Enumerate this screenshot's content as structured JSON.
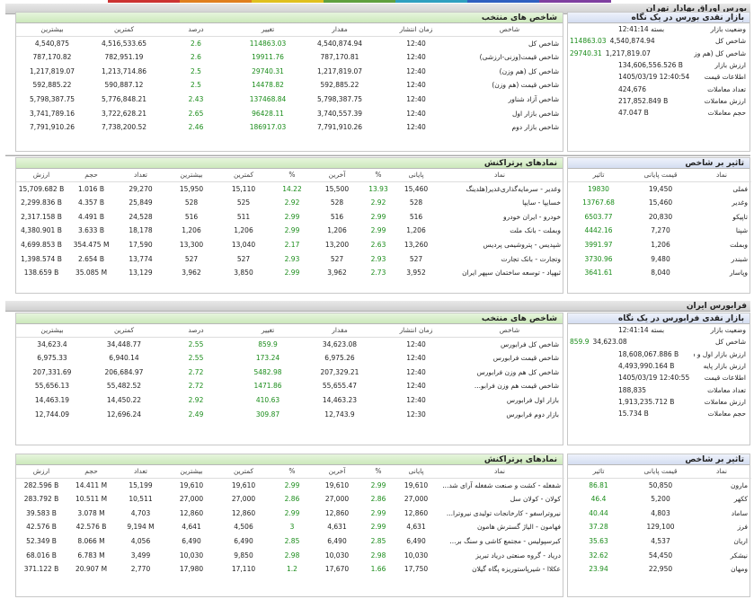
{
  "colors": {
    "up": "#1a8c1a",
    "down": "#cc0000",
    "green_header": "#cce8bb",
    "blue_header": "#d4ddf1",
    "top_strip": [
      "#cc3333",
      "#e08020",
      "#e0c020",
      "#60a040",
      "#30a0c0",
      "#3060c0",
      "#8040a0"
    ]
  },
  "tse": {
    "title": "بورس اوراق بهادار تهران",
    "glance": {
      "title": "بازار نقدی بورس در یک نگاه",
      "rows": [
        {
          "label": "وضعیت بازار",
          "value": "بسته 12:41:14",
          "change": ""
        },
        {
          "label": "شاخص کل",
          "value": "4,540,874.94",
          "change": "114863.03"
        },
        {
          "label": "شاخص کل (هم وزن)",
          "value": "1,217,819.07",
          "change": "29740.31"
        },
        {
          "label": "ارزش بازار",
          "value": "134,606,556.526 B",
          "change": ""
        },
        {
          "label": "اطلاعات قیمت",
          "value": "1405/03/19 12:40:54",
          "change": ""
        },
        {
          "label": "تعداد معاملات",
          "value": "424,676",
          "change": ""
        },
        {
          "label": "ارزش معاملات",
          "value": "217,852.849 B",
          "change": ""
        },
        {
          "label": "حجم معاملات",
          "value": "47.047 B",
          "change": ""
        }
      ]
    },
    "indices": {
      "title": "شاخص های منتخب",
      "headers": [
        "شاخص",
        "زمان انتشار",
        "مقدار",
        "تغییر",
        "درصد",
        "کمترین",
        "بیشترین"
      ],
      "rows": [
        [
          "شاخص کل",
          "12:40",
          "4,540,874.94",
          "114863.03",
          "2.6",
          "4,516,533.65",
          "4,540,875"
        ],
        [
          "شاخص قیمت(وزنی-ارزشی)",
          "12:40",
          "787,170.81",
          "19911.76",
          "2.6",
          "782,951.19",
          "787,170.82"
        ],
        [
          "شاخص کل (هم وزن)",
          "12:40",
          "1,217,819.07",
          "29740.31",
          "2.5",
          "1,213,714.86",
          "1,217,819.07"
        ],
        [
          "شاخص قیمت (هم وزن)",
          "12:40",
          "592,885.22",
          "14478.82",
          "2.5",
          "590,887.12",
          "592,885.22"
        ],
        [
          "شاخص آزاد شناور",
          "12:40",
          "5,798,387.75",
          "137468.84",
          "2.43",
          "5,776,848.21",
          "5,798,387.75"
        ],
        [
          "شاخص بازار اول",
          "12:40",
          "3,740,557.39",
          "96428.11",
          "2.65",
          "3,722,628.21",
          "3,741,789.16"
        ],
        [
          "شاخص بازار دوم",
          "12:40",
          "7,791,910.26",
          "186917.03",
          "2.46",
          "7,738,200.52",
          "7,791,910.26"
        ]
      ]
    },
    "symbols": {
      "title": "نمادهای پرتراکنش",
      "headers": [
        "نماد",
        "پایانی",
        "%",
        "آخرین",
        "%",
        "کمترین",
        "بیشترین",
        "تعداد",
        "حجم",
        "ارزش"
      ],
      "rows": [
        [
          "وغدیر - سرمایه‌گذاری‌غدیر(هلدینگ",
          "15,460",
          "13.93",
          "15,500",
          "14.22",
          "15,110",
          "15,950",
          "29,270",
          "1.016 B",
          "15,709.682 B"
        ],
        [
          "خسایپا - سایپا",
          "528",
          "2.92",
          "528",
          "2.92",
          "525",
          "528",
          "25,849",
          "4.357 B",
          "2,299.836 B"
        ],
        [
          "خودرو - ایران‌ خودرو",
          "516",
          "2.99",
          "516",
          "2.99",
          "511",
          "516",
          "24,528",
          "4.491 B",
          "2,317.158 B"
        ],
        [
          "وبملت - بانک ملت",
          "1,206",
          "2.99",
          "1,206",
          "2.99",
          "1,206",
          "1,206",
          "18,178",
          "3.633 B",
          "4,380.901 B"
        ],
        [
          "شپدیس - پتروشیمی پردیس",
          "13,260",
          "2.63",
          "13,200",
          "2.17",
          "13,040",
          "13,300",
          "17,590",
          "354.475 M",
          "4,699.853 B"
        ],
        [
          "وتجارت - بانک تجارت",
          "527",
          "2.93",
          "527",
          "2.93",
          "527",
          "527",
          "13,774",
          "2.654 B",
          "1,398.574 B"
        ],
        [
          "ثبهپاد - توسعه ساختمان سپهر ایران",
          "3,952",
          "2.73",
          "3,962",
          "2.99",
          "3,850",
          "3,962",
          "13,129",
          "35.085 M",
          "138.659 B"
        ]
      ]
    },
    "impact": {
      "title": "تاثیر بر شاخص",
      "headers": [
        "نماد",
        "قیمت پایانی",
        "تاثیر"
      ],
      "rows": [
        [
          "فملی",
          "19,450",
          "19830"
        ],
        [
          "وغدیر",
          "15,460",
          "13767.68"
        ],
        [
          "تاپیکو",
          "20,830",
          "6503.77"
        ],
        [
          "شپنا",
          "7,270",
          "4442.16"
        ],
        [
          "وبملت",
          "1,206",
          "3991.97"
        ],
        [
          "شبندر",
          "9,480",
          "3730.96"
        ],
        [
          "وپاسار",
          "8,040",
          "3641.61"
        ]
      ]
    }
  },
  "ifb": {
    "title": "فرابورس ایران",
    "glance": {
      "title": "بازار نقدی فرابورس در یک نگاه",
      "rows": [
        {
          "label": "وضعیت بازار",
          "value": "بسته 12:41:14",
          "change": ""
        },
        {
          "label": "شاخص کل",
          "value": "34,623.08",
          "change": "859.9"
        },
        {
          "label": "ارزش بازار اول و دوم",
          "value": "18,608,067.886 B",
          "change": ""
        },
        {
          "label": "ارزش بازار پایه",
          "value": "4,493,990.164 B",
          "change": ""
        },
        {
          "label": "اطلاعات قیمت",
          "value": "1405/03/19 12:40:55",
          "change": ""
        },
        {
          "label": "تعداد معاملات",
          "value": "188,835",
          "change": ""
        },
        {
          "label": "ارزش معاملات",
          "value": "1,913,235.712 B",
          "change": ""
        },
        {
          "label": "حجم معاملات",
          "value": "15.734 B",
          "change": ""
        }
      ]
    },
    "indices": {
      "title": "شاخص های منتخب",
      "headers": [
        "شاخص",
        "زمان انتشار",
        "مقدار",
        "تغییر",
        "درصد",
        "کمترین",
        "بیشترین"
      ],
      "rows": [
        [
          "شاخص کل فرابورس",
          "12:40",
          "34,623.08",
          "859.9",
          "2.55",
          "34,448.77",
          "34,623.4"
        ],
        [
          "شاخص قیمت فرابورس",
          "12:40",
          "6,975.26",
          "173.24",
          "2.55",
          "6,940.14",
          "6,975.33"
        ],
        [
          "شاخص کل هم وزن فرابورس",
          "12:40",
          "207,329.21",
          "5482.98",
          "2.72",
          "206,684.97",
          "207,331.69"
        ],
        [
          "شاخص قیمت هم وزن فرابو...",
          "12:40",
          "55,655.47",
          "1471.86",
          "2.72",
          "55,482.52",
          "55,656.13"
        ],
        [
          "بازار اول فرابورس",
          "12:40",
          "14,463.23",
          "410.63",
          "2.92",
          "14,450.22",
          "14,463.19"
        ],
        [
          "بازار دوم فرابورس",
          "12:30",
          "12,743.9",
          "309.87",
          "2.49",
          "12,696.24",
          "12,744.09"
        ]
      ]
    },
    "symbols": {
      "title": "نمادهای پرتراکنش",
      "headers": [
        "نماد",
        "پایانی",
        "%",
        "آخرین",
        "%",
        "کمترین",
        "بیشترین",
        "تعداد",
        "حجم",
        "ارزش"
      ],
      "rows": [
        [
          "شفغله - کشت و صنعت شفغله آرای شد...",
          "19,610",
          "2.99",
          "19,610",
          "2.99",
          "19,610",
          "19,610",
          "15,199",
          "14.411 M",
          "282.596 B"
        ],
        [
          "کولان - کولان سل",
          "27,000",
          "2.86",
          "27,000",
          "2.86",
          "27,000",
          "27,000",
          "10,511",
          "10.511 M",
          "283.792 B"
        ],
        [
          "نیروتراسفو - کارخانجات تولیدی نیروترا...",
          "12,860",
          "2.99",
          "12,860",
          "2.99",
          "12,860",
          "12,860",
          "4,703",
          "3.078 M",
          "39.583 B"
        ],
        [
          "فهامون - الیاژ گسترش هامون",
          "4,631",
          "2.99",
          "4,631",
          "3",
          "4,506",
          "4,641",
          "9,194 M",
          "42.576 B",
          "42.576 B"
        ],
        [
          "کبرسپولیس - مجتمع کاشی و سنگ بر...",
          "6,490",
          "2.85",
          "6,490",
          "2.85",
          "6,490",
          "6,490",
          "4,056",
          "8.066 M",
          "52.349 B"
        ],
        [
          "دریاد - گروه صنعتی دریاد تبریز",
          "10,030",
          "2.98",
          "10,030",
          "2.98",
          "9,850",
          "10,030",
          "3,499",
          "6.783 M",
          "68.016 B"
        ],
        [
          "عکلاا - شیرپاستوریزه پگاه گیلان",
          "17,750",
          "1.66",
          "17,670",
          "1.2",
          "17,110",
          "17,980",
          "2,770",
          "20.907 M",
          "371.122 B"
        ]
      ]
    },
    "impact": {
      "title": "تاثیر بر شاخص",
      "headers": [
        "نماد",
        "قیمت پایانی",
        "تاثیر"
      ],
      "rows": [
        [
          "مارون",
          "50,850",
          "86.81"
        ],
        [
          "ککهر",
          "5,200",
          "46.4"
        ],
        [
          "ساماد",
          "4,803",
          "40.44"
        ],
        [
          "فرز",
          "129,100",
          "37.28"
        ],
        [
          "اریان",
          "4,537",
          "35.63"
        ],
        [
          "نیشکر",
          "54,450",
          "32.62"
        ],
        [
          "ومهان",
          "22,950",
          "23.94"
        ]
      ]
    }
  }
}
